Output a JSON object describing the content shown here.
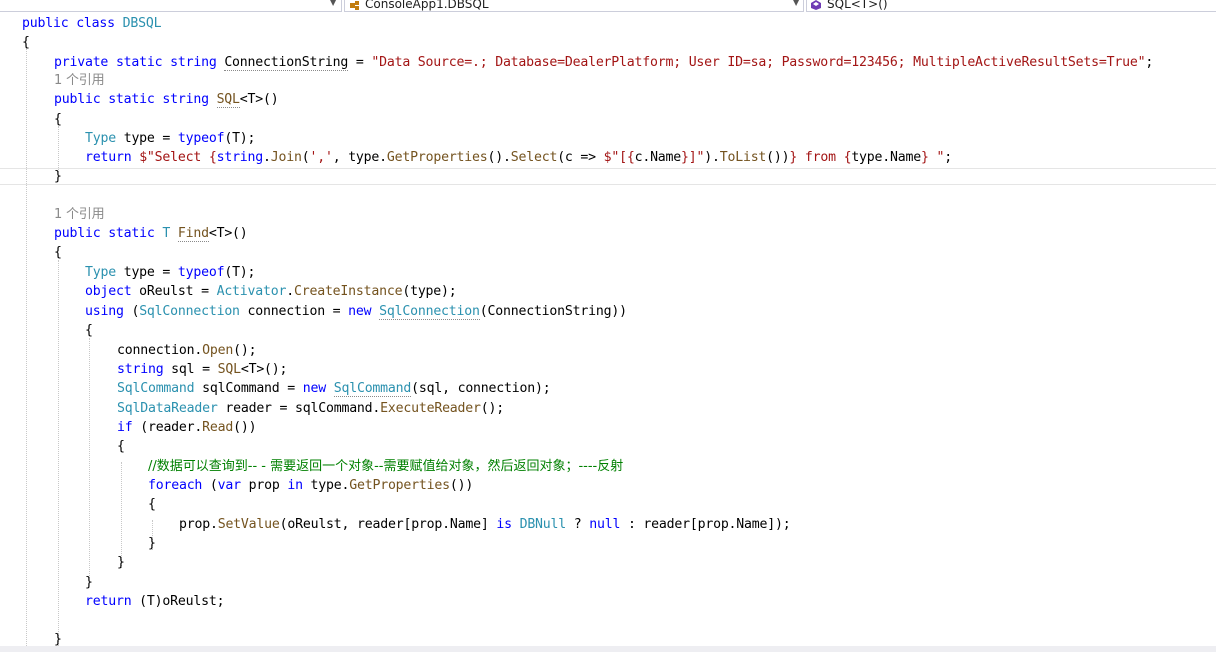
{
  "navbar": {
    "project_dropdown": "",
    "class_dropdown": "ConsoleApp1.DBSQL",
    "member_dropdown": "SQL<T>()"
  },
  "code": {
    "l1": {
      "kw1": "public",
      "kw2": "class",
      "name": "DBSQL"
    },
    "l2": "{",
    "l3": {
      "kw1": "private",
      "kw2": "static",
      "kw3": "string",
      "name": "ConnectionString",
      "eq": " = ",
      "str": "\"Data Source=.; Database=DealerPlatform; User ID=sa; Password=123456; MultipleActiveResultSets=True\"",
      "end": ";"
    },
    "l4": "1 个引用",
    "l5": {
      "kw1": "public",
      "kw2": "static",
      "kw3": "string",
      "name": "SQL",
      "rest": "<T>()"
    },
    "l6": "{",
    "l7": {
      "ty": "Type",
      "a": " type = ",
      "kw": "typeof",
      "b": "(T);"
    },
    "l8": {
      "kw": "return",
      "a": " ",
      "str1": "$\"Select {",
      "kw2": "string",
      "b": ".",
      "m1": "Join",
      "c": "(",
      "str2": "','",
      "d": ", type.",
      "m2": "GetProperties",
      "e": "().",
      "m3": "Select",
      "f": "(c => ",
      "str3": "$\"[{",
      "g": "c.Name",
      "str4": "}]\"",
      "h": ").",
      "m4": "ToList",
      "i": "())",
      "str5": "} from {",
      "j": "type.Name",
      "str6": "} \"",
      "k": ";"
    },
    "l9": "}",
    "l10": "1 个引用",
    "l11": {
      "kw1": "public",
      "kw2": "static",
      "ty": "T",
      "name": "Find",
      "rest": "<T>()"
    },
    "l12": "{",
    "l13": {
      "ty": "Type",
      "a": " type = ",
      "kw": "typeof",
      "b": "(T);"
    },
    "l14": {
      "kw": "object",
      "a": " oReulst = ",
      "ty": "Activator",
      "b": ".",
      "m": "CreateInstance",
      "c": "(type);"
    },
    "l15": {
      "kw": "using",
      "a": " (",
      "ty": "SqlConnection",
      "b": " connection = ",
      "kw2": "new",
      "c": " ",
      "ty2": "SqlConnection",
      "d": "(ConnectionString))"
    },
    "l16": "{",
    "l17": {
      "a": "connection.",
      "m": "Open",
      "b": "();"
    },
    "l18": {
      "kw": "string",
      "a": " sql = ",
      "m": "SQL",
      "b": "<T>();"
    },
    "l19": {
      "ty": "SqlCommand",
      "a": " sqlCommand = ",
      "kw": "new",
      "b": " ",
      "ty2": "SqlCommand",
      "c": "(sql, connection);"
    },
    "l20": {
      "ty": "SqlDataReader",
      "a": " reader = sqlCommand.",
      "m": "ExecuteReader",
      "b": "();"
    },
    "l21": {
      "kw": "if",
      "a": " (reader.",
      "m": "Read",
      "b": "())"
    },
    "l22": "{",
    "l23": "//数据可以查询到-- - 需要返回一个对象--需要赋值给对象，然后返回对象；----反射",
    "l24": {
      "kw": "foreach",
      "a": " (",
      "kw2": "var",
      "b": " prop ",
      "kw3": "in",
      "c": " type.",
      "m": "GetProperties",
      "d": "())"
    },
    "l25": "{",
    "l26": {
      "a": "prop.",
      "m": "SetValue",
      "b": "(oReulst, reader[prop.Name] ",
      "kw": "is",
      "c": " ",
      "ty": "DBNull",
      "d": " ? ",
      "kw2": "null",
      "e": " : reader[prop.Name]);"
    },
    "l27": "}",
    "l28": "}",
    "l29": "}",
    "l30": {
      "kw": "return",
      "a": " (T)oReulst;"
    },
    "l31": "}"
  }
}
